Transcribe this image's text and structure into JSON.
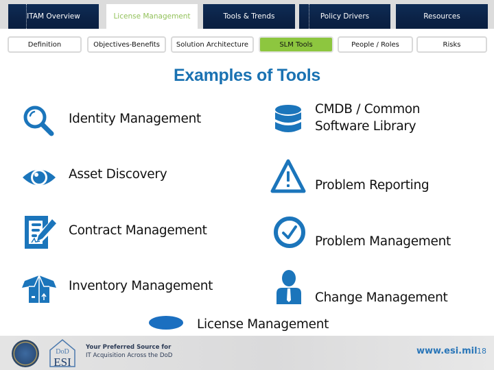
{
  "nav": {
    "tabs": [
      {
        "label": "ITAM Overview",
        "active": false
      },
      {
        "label": "License Management",
        "active": true
      },
      {
        "label": "Tools & Trends",
        "active": false
      },
      {
        "label": "Policy Drivers",
        "active": false
      },
      {
        "label": "Resources",
        "active": false
      }
    ],
    "subtabs": [
      {
        "label": "Definition",
        "active": false
      },
      {
        "label": "Objectives-Benefits",
        "active": false
      },
      {
        "label": "Solution Architecture",
        "active": false
      },
      {
        "label": "SLM Tools",
        "active": true
      },
      {
        "label": "People / Roles",
        "active": false
      },
      {
        "label": "Risks",
        "active": false
      }
    ]
  },
  "slide": {
    "title": "Examples of Tools",
    "left_items": [
      {
        "icon": "magnifier-icon",
        "label": "Identity Management"
      },
      {
        "icon": "eye-icon",
        "label": "Asset Discovery"
      },
      {
        "icon": "contract-icon",
        "label": "Contract Management"
      },
      {
        "icon": "box-icon",
        "label": "Inventory Management"
      }
    ],
    "right_items": [
      {
        "icon": "database-icon",
        "label_line1": "CMDB /  Common",
        "label_line2": "Software Library"
      },
      {
        "icon": "warning-icon",
        "label": "Problem Reporting"
      },
      {
        "icon": "checkmark-circle-icon",
        "label": "Problem Management"
      },
      {
        "icon": "person-icon",
        "label": "Change Management"
      }
    ],
    "bottom_item": {
      "icon": "ellipse-icon",
      "label": "License Management"
    }
  },
  "footer": {
    "logo_text_top": "DoD",
    "logo_text_main": "ESI",
    "tagline_line1": "Your Preferred Source for",
    "tagline_line2": "IT Acquisition Across the DoD",
    "url": "www.esi.mil",
    "page_number": "18"
  },
  "colors": {
    "accent_blue": "#1a72b2",
    "icon_blue": "#1b75bb",
    "nav_dark": "#0c2448",
    "active_green": "#8dc63f",
    "active_tab_text": "#92c15a"
  }
}
